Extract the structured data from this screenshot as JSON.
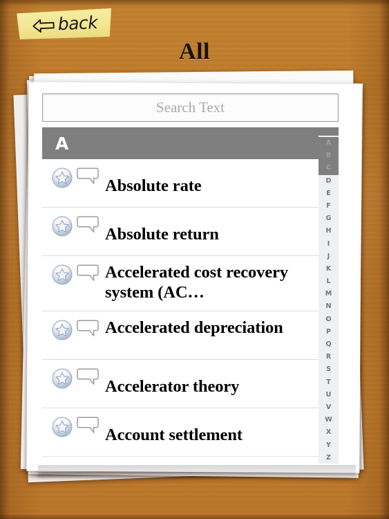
{
  "screen": {
    "title": "All",
    "background_color": "#c07d2f",
    "card_color": "#ffffff"
  },
  "back_button": {
    "label": "back",
    "icon": "left-arrow-icon",
    "note_color": "#f3e694"
  },
  "search": {
    "value": "",
    "placeholder": "Search Text"
  },
  "section": {
    "letter": "A",
    "header_color": "#7f7f7f"
  },
  "list": {
    "row_icons": {
      "favorite": "star-icon",
      "note": "speech-bubble-icon"
    },
    "items": [
      {
        "term": "Absolute rate",
        "lines": 1
      },
      {
        "term": "Absolute return",
        "lines": 1
      },
      {
        "term": "Accelerated cost recovery system (AC…",
        "lines": 2
      },
      {
        "term": "Accelerated depreciation",
        "lines": 2
      },
      {
        "term": "Accelerator theory",
        "lines": 1
      },
      {
        "term": "Account settlement",
        "lines": 1
      }
    ]
  },
  "alpha_index": {
    "letters": [
      "A",
      "B",
      "C",
      "D",
      "E",
      "F",
      "G",
      "H",
      "I",
      "J",
      "K",
      "L",
      "M",
      "N",
      "O",
      "P",
      "Q",
      "R",
      "S",
      "T",
      "U",
      "V",
      "W",
      "X",
      "Y",
      "Z"
    ],
    "overlapping_header_count": 3,
    "text_color": "#72757c",
    "background_color": "#eff0f2"
  }
}
